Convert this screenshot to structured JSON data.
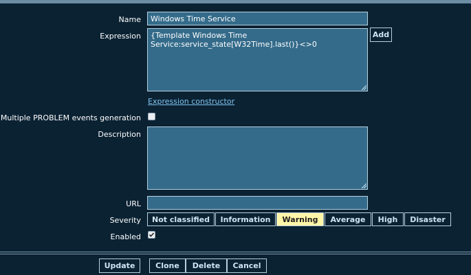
{
  "form": {
    "name_label": "Name",
    "name_value": "Windows Time Service",
    "expression_label": "Expression",
    "expression_value": "{Template Windows Time\nService:service_state[W32Time].last()}<>0",
    "add_label": "Add",
    "expression_constructor_label": "Expression constructor",
    "multiple_events_label": "Multiple PROBLEM events generation",
    "multiple_events_checked": false,
    "description_label": "Description",
    "description_value": "",
    "url_label": "URL",
    "url_value": "",
    "severity_label": "Severity",
    "severity_options": [
      "Not classified",
      "Information",
      "Warning",
      "Average",
      "High",
      "Disaster"
    ],
    "severity_selected": "Warning",
    "enabled_label": "Enabled",
    "enabled_checked": true
  },
  "footer": {
    "update_label": "Update",
    "clone_label": "Clone",
    "delete_label": "Delete",
    "cancel_label": "Cancel"
  },
  "colors": {
    "background": "#0b2233",
    "input_bg": "#346b8a",
    "input_border": "#b8d0de",
    "link": "#7fc4ef",
    "selected_severity": "#fff6a8"
  }
}
